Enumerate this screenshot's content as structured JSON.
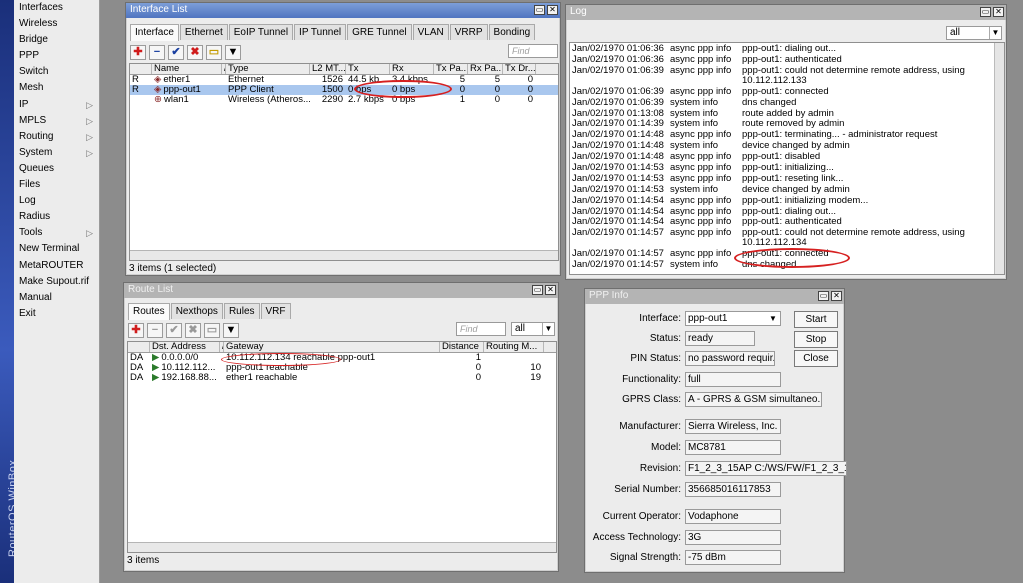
{
  "app": {
    "brand": "RouterOS WinBox"
  },
  "sidebar": {
    "items": [
      {
        "label": "Interfaces",
        "sub": false
      },
      {
        "label": "Wireless",
        "sub": false
      },
      {
        "label": "Bridge",
        "sub": false
      },
      {
        "label": "PPP",
        "sub": false
      },
      {
        "label": "Switch",
        "sub": false
      },
      {
        "label": "Mesh",
        "sub": false
      },
      {
        "label": "IP",
        "sub": true
      },
      {
        "label": "MPLS",
        "sub": true
      },
      {
        "label": "Routing",
        "sub": true
      },
      {
        "label": "System",
        "sub": true
      },
      {
        "label": "Queues",
        "sub": false
      },
      {
        "label": "Files",
        "sub": false
      },
      {
        "label": "Log",
        "sub": false
      },
      {
        "label": "Radius",
        "sub": false
      },
      {
        "label": "Tools",
        "sub": true
      },
      {
        "label": "New Terminal",
        "sub": false
      },
      {
        "label": "MetaROUTER",
        "sub": false
      },
      {
        "label": "Make Supout.rif",
        "sub": false
      },
      {
        "label": "Manual",
        "sub": false
      },
      {
        "label": "Exit",
        "sub": false
      }
    ],
    "submenu_glyph": "▷"
  },
  "interface_window": {
    "title": "Interface List",
    "tabs": [
      "Interface",
      "Ethernet",
      "EoIP Tunnel",
      "IP Tunnel",
      "GRE Tunnel",
      "VLAN",
      "VRRP",
      "Bonding"
    ],
    "find_placeholder": "Find",
    "columns": [
      "",
      "Name",
      "/",
      "Type",
      "L2 MT...",
      "Tx",
      "Rx",
      "Tx Pa...",
      "Rx Pa...",
      "Tx Dr..."
    ],
    "rows": [
      {
        "flag": "R",
        "name": "ether1",
        "type": "Ethernet",
        "l2mtu": "1526",
        "tx": "44.5 kb...",
        "rx": "3.4 kbps",
        "txp": "5",
        "rxp": "5",
        "txd": "0",
        "selected": false
      },
      {
        "flag": "R",
        "name": "ppp-out1",
        "type": "PPP Client",
        "l2mtu": "1500",
        "tx": "0 bps",
        "rx": "0 bps",
        "txp": "0",
        "rxp": "0",
        "txd": "0",
        "selected": true
      },
      {
        "flag": "",
        "name": "wlan1",
        "type": "Wireless (Atheros...",
        "l2mtu": "2290",
        "tx": "2.7 kbps",
        "rx": "0 bps",
        "txp": "1",
        "rxp": "0",
        "txd": "0",
        "selected": false
      }
    ],
    "status": "3 items (1 selected)"
  },
  "route_window": {
    "title": "Route List",
    "tabs": [
      "Routes",
      "Nexthops",
      "Rules",
      "VRF"
    ],
    "find_placeholder": "Find",
    "filter_value": "all",
    "columns": [
      "",
      "Dst. Address",
      "/",
      "Gateway",
      "Distance",
      "Routing M..."
    ],
    "rows": [
      {
        "flag": "DA",
        "dst": "0.0.0.0/0",
        "gateway": "10.112.112.134 reachable ppp-out1",
        "distance": "1",
        "rm": ""
      },
      {
        "flag": "DA",
        "dst": "10.112.112...",
        "gateway": "ppp-out1 reachable",
        "distance": "0",
        "rm": "10"
      },
      {
        "flag": "DA",
        "dst": "192.168.88...",
        "gateway": "ether1 reachable",
        "distance": "0",
        "rm": "19"
      }
    ],
    "status": "3 items"
  },
  "log_window": {
    "title": "Log",
    "filter_value": "all",
    "rows": [
      {
        "time": "Jan/02/1970 01:06:36",
        "topic": "async ppp info",
        "msg": "ppp-out1: dialing out..."
      },
      {
        "time": "Jan/02/1970 01:06:36",
        "topic": "async ppp info",
        "msg": "ppp-out1: authenticated"
      },
      {
        "time": "Jan/02/1970 01:06:39",
        "topic": "async ppp info",
        "msg": "ppp-out1: could not determine remote address, using 10.112.112.133"
      },
      {
        "time": "Jan/02/1970 01:06:39",
        "topic": "async ppp info",
        "msg": "ppp-out1: connected"
      },
      {
        "time": "Jan/02/1970 01:06:39",
        "topic": "system info",
        "msg": "dns changed"
      },
      {
        "time": "Jan/02/1970 01:13:08",
        "topic": "system info",
        "msg": "route added by admin"
      },
      {
        "time": "Jan/02/1970 01:14:39",
        "topic": "system info",
        "msg": "route removed by admin"
      },
      {
        "time": "Jan/02/1970 01:14:48",
        "topic": "async ppp info",
        "msg": "ppp-out1: terminating... - administrator request"
      },
      {
        "time": "Jan/02/1970 01:14:48",
        "topic": "system info",
        "msg": "device changed by admin"
      },
      {
        "time": "Jan/02/1970 01:14:48",
        "topic": "async ppp info",
        "msg": "ppp-out1: disabled"
      },
      {
        "time": "Jan/02/1970 01:14:53",
        "topic": "async ppp info",
        "msg": "ppp-out1: initializing..."
      },
      {
        "time": "Jan/02/1970 01:14:53",
        "topic": "async ppp info",
        "msg": "ppp-out1: reseting link..."
      },
      {
        "time": "Jan/02/1970 01:14:53",
        "topic": "system info",
        "msg": "device changed by admin"
      },
      {
        "time": "Jan/02/1970 01:14:54",
        "topic": "async ppp info",
        "msg": "ppp-out1: initializing modem..."
      },
      {
        "time": "Jan/02/1970 01:14:54",
        "topic": "async ppp info",
        "msg": "ppp-out1: dialing out..."
      },
      {
        "time": "Jan/02/1970 01:14:54",
        "topic": "async ppp info",
        "msg": "ppp-out1: authenticated"
      },
      {
        "time": "Jan/02/1970 01:14:57",
        "topic": "async ppp info",
        "msg": "ppp-out1: could not determine remote address, using 10.112.112.134"
      },
      {
        "time": "Jan/02/1970 01:14:57",
        "topic": "async ppp info",
        "msg": "ppp-out1: connected"
      },
      {
        "time": "Jan/02/1970 01:14:57",
        "topic": "system info",
        "msg": "dns changed"
      }
    ]
  },
  "ppp_info": {
    "title": "PPP Info",
    "fields": [
      {
        "label": "Interface:",
        "value": "ppp-out1"
      },
      {
        "label": "Status:",
        "value": "ready"
      },
      {
        "label": "PIN Status:",
        "value": "no password requir..."
      },
      {
        "label": "Functionality:",
        "value": "full"
      },
      {
        "label": "GPRS Class:",
        "value": "A - GPRS & GSM simultaneo..."
      },
      {
        "label": "Manufacturer:",
        "value": "Sierra Wireless, Inc."
      },
      {
        "label": "Model:",
        "value": "MC8781"
      },
      {
        "label": "Revision:",
        "value": "F1_2_3_15AP C:/WS/FW/F1_2_3_15"
      },
      {
        "label": "Serial Number:",
        "value": "356685016117853"
      },
      {
        "label": "Current Operator:",
        "value": "Vodaphone"
      },
      {
        "label": "Access Technology:",
        "value": "3G"
      },
      {
        "label": "Signal Strength:",
        "value": "-75 dBm"
      }
    ],
    "buttons": {
      "start": "Start",
      "stop": "Stop",
      "close": "Close"
    }
  },
  "colors": {
    "selection": "#a9c7ee",
    "annotation": "#d62020",
    "titlebar_active": "#4f74c0"
  }
}
